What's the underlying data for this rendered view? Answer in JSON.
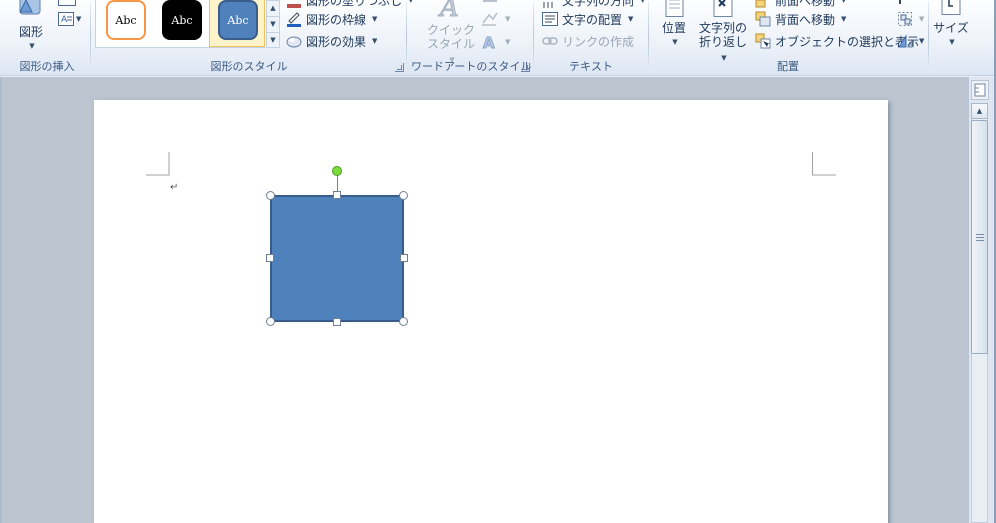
{
  "ribbon": {
    "insert_shapes": {
      "label": "図形の挿入",
      "shapes_button": "図形"
    },
    "shape_styles": {
      "label": "図形のスタイル",
      "swatches": [
        "Abc",
        "Abc",
        "Abc"
      ],
      "fill_partial": "図形の塗りつぶし",
      "outline": "図形の枠線",
      "effects": "図形の効果"
    },
    "wordart_styles": {
      "label": "ワードアートのスタイル",
      "quick_styles_line1": "クイック",
      "quick_styles_line2": "スタイル"
    },
    "text": {
      "label": "テキスト",
      "direction_partial": "文字列の方向",
      "align_text": "文字の配置",
      "create_link": "リンクの作成"
    },
    "arrange": {
      "label": "配置",
      "position": "位置",
      "wrap_line1": "文字列の",
      "wrap_line2": "折り返し",
      "bring_forward_partial": "前面へ移動",
      "send_backward": "背面へ移動",
      "selection_pane": "オブジェクトの選択と表示"
    },
    "size": {
      "label": "サイズ"
    }
  },
  "document": {
    "paragraph_mark": "↵"
  },
  "colors": {
    "shape_fill": "#4f81bd",
    "shape_border": "#385d8a",
    "rotation_handle": "#7cdd3a",
    "swatch_orange_border": "#f79646",
    "swatch_black": "#000000",
    "swatch_blue": "#4f81bd"
  }
}
